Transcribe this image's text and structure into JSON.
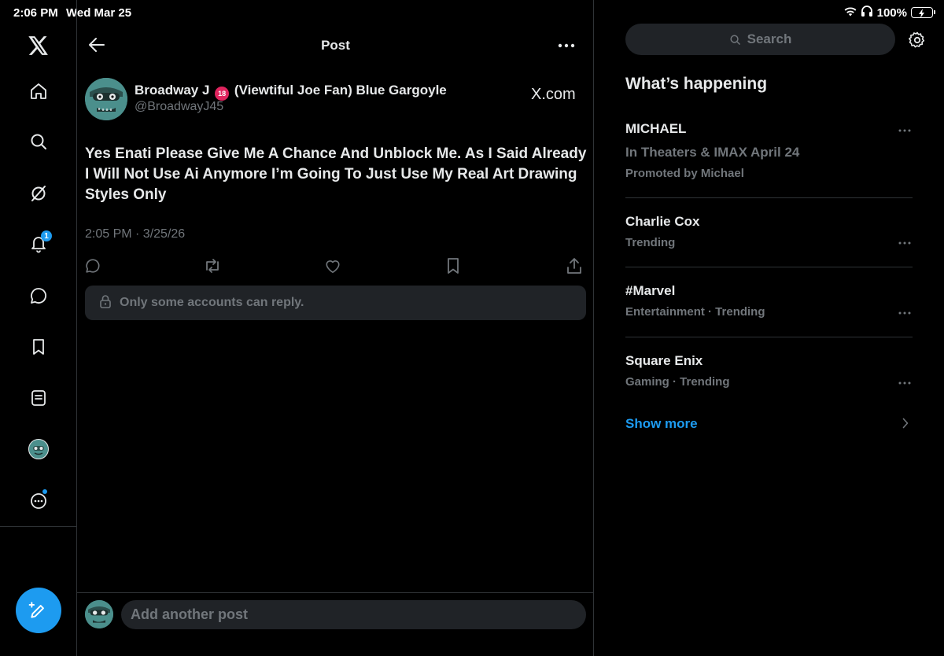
{
  "status_bar": {
    "time": "2:06 PM",
    "date": "Wed Mar 25",
    "battery": "100%"
  },
  "nav": {
    "notifications_badge": "1"
  },
  "header": {
    "title": "Post"
  },
  "post": {
    "author_name_prefix": "Broadway J",
    "age_badge": "18",
    "author_name_suffix": "(Viewtiful Joe Fan) Blue Gargoyle",
    "handle": "@BroadwayJ45",
    "source": "X.com",
    "text": "Yes Enati Please Give Me A Chance And Unblock Me. As I Said Already I Will Not Use Ai Anymore I’m Going To Just Use My Real Art Drawing Styles Only",
    "timestamp": "2:05 PM · 3/25/26",
    "reply_restriction": "Only some accounts can reply."
  },
  "compose": {
    "placeholder": "Add another post"
  },
  "sidebar": {
    "search_placeholder": "Search",
    "section_title": "What’s happening",
    "trends": [
      {
        "name": "MICHAEL",
        "subtitle": "In Theaters & IMAX April 24",
        "meta": "Promoted by Michael"
      },
      {
        "name": "Charlie Cox",
        "meta": "Trending"
      },
      {
        "name": "#Marvel",
        "meta": "Entertainment · Trending"
      },
      {
        "name": "Square Enix",
        "meta": "Gaming · Trending"
      }
    ],
    "show_more": "Show more"
  },
  "colors": {
    "background": "#000000",
    "text_primary": "#e7e9ea",
    "text_secondary": "#71767b",
    "accent": "#1d9bf0",
    "surface": "#202327",
    "divider": "#2f3336",
    "battery": "#34c759"
  }
}
